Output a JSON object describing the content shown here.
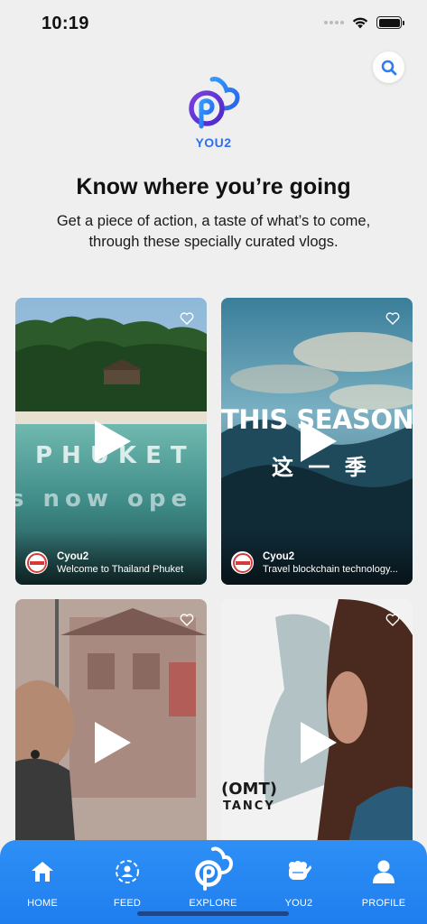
{
  "status": {
    "time": "10:19"
  },
  "brand": {
    "name": "YOU2",
    "accent": "#2e6ff0",
    "purple": "#6a3ad8"
  },
  "hero": {
    "headline": "Know where you’re going",
    "subtext": "Get a piece of action, a taste of what’s to come, through these specially curated vlogs."
  },
  "cards": [
    {
      "author": "Cyou2",
      "title": "Welcome to Thailand Phuket",
      "overlay_line1": "PHUKET",
      "overlay_line2": "s now ope"
    },
    {
      "author": "Cyou2",
      "title": "Travel blockchain technology...",
      "overlay_line1": "THIS SEASON",
      "overlay_line2": "这 一 季"
    },
    {
      "author": "",
      "title": "",
      "overlay_line1": "",
      "overlay_line2": ""
    },
    {
      "author": "",
      "title": "",
      "overlay_line1": "(OMT)",
      "overlay_line2": "TANCY"
    }
  ],
  "tabs": [
    {
      "label": "HOME",
      "icon": "home-icon"
    },
    {
      "label": "FEED",
      "icon": "feed-icon"
    },
    {
      "label": "EXPLORE",
      "icon": "explore-logo-icon"
    },
    {
      "label": "YOU2",
      "icon": "fist-icon"
    },
    {
      "label": "PROFILE",
      "icon": "person-icon"
    }
  ],
  "colors": {
    "tabbar": "#2385f2",
    "background": "#efefef"
  }
}
